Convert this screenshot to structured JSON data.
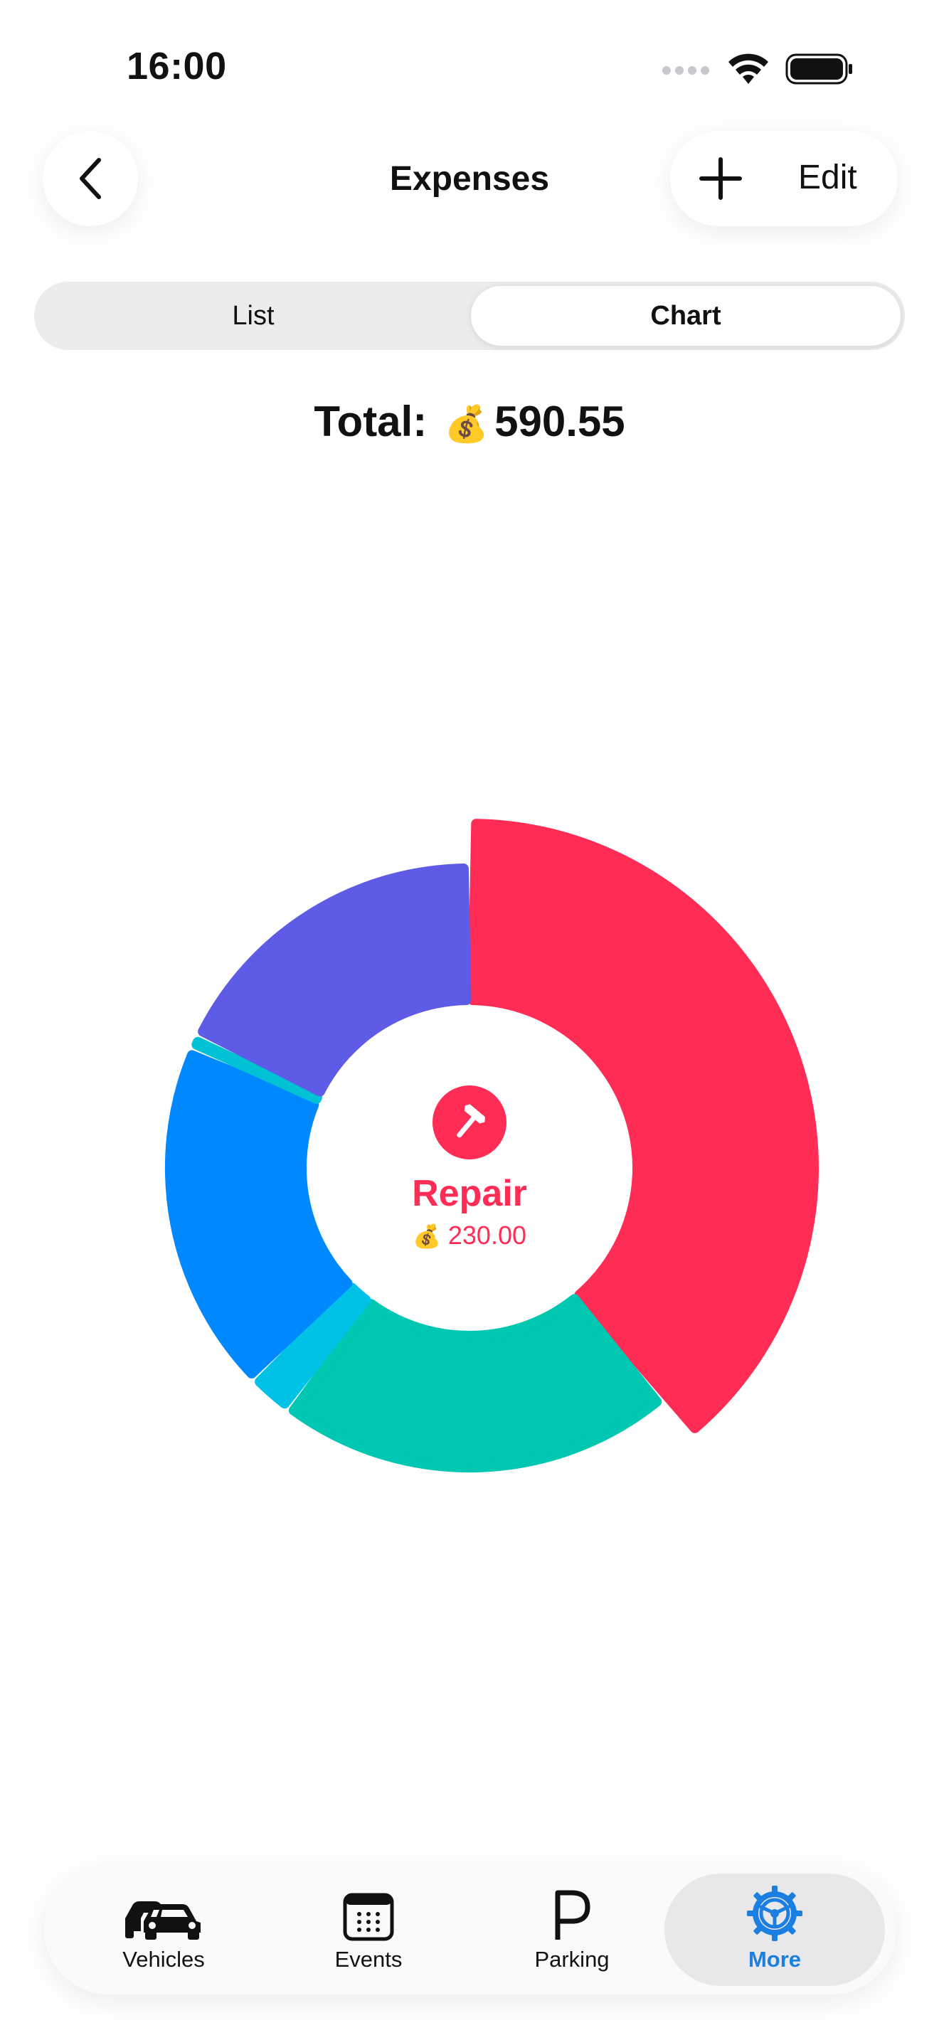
{
  "status_bar": {
    "time": "16:00"
  },
  "nav": {
    "title": "Expenses",
    "edit_label": "Edit"
  },
  "segments": {
    "list": "List",
    "chart": "Chart",
    "selected": "Chart"
  },
  "total": {
    "label": "Total:",
    "emoji": "💰",
    "value": "590.55"
  },
  "center": {
    "category": "Repair",
    "emoji": "💰",
    "value": "230.00",
    "icon": "hammer-icon",
    "color": "#ff2d55"
  },
  "chart_data": {
    "type": "pie",
    "style": "donut",
    "total": 590.55,
    "slices": [
      {
        "value": 230.0,
        "color": "#ff2d55"
      },
      {
        "value": 126.0,
        "color": "#00c7b1"
      },
      {
        "value": 14.0,
        "color": "#00c2e6"
      },
      {
        "value": 111.0,
        "color": "#0088ff"
      },
      {
        "value": 4.55,
        "color": "#00c2d4"
      },
      {
        "value": 105.0,
        "color": "#5e5ce6"
      }
    ]
  },
  "tabs": [
    {
      "label": "Vehicles",
      "icon": "cars-icon"
    },
    {
      "label": "Events",
      "icon": "calendar-icon"
    },
    {
      "label": "Parking",
      "icon": "parking-icon"
    },
    {
      "label": "More",
      "icon": "steering-wheel-icon",
      "selected": true
    }
  ],
  "colors": {
    "accent": "#1a7fe0",
    "repair": "#ff2d55"
  }
}
